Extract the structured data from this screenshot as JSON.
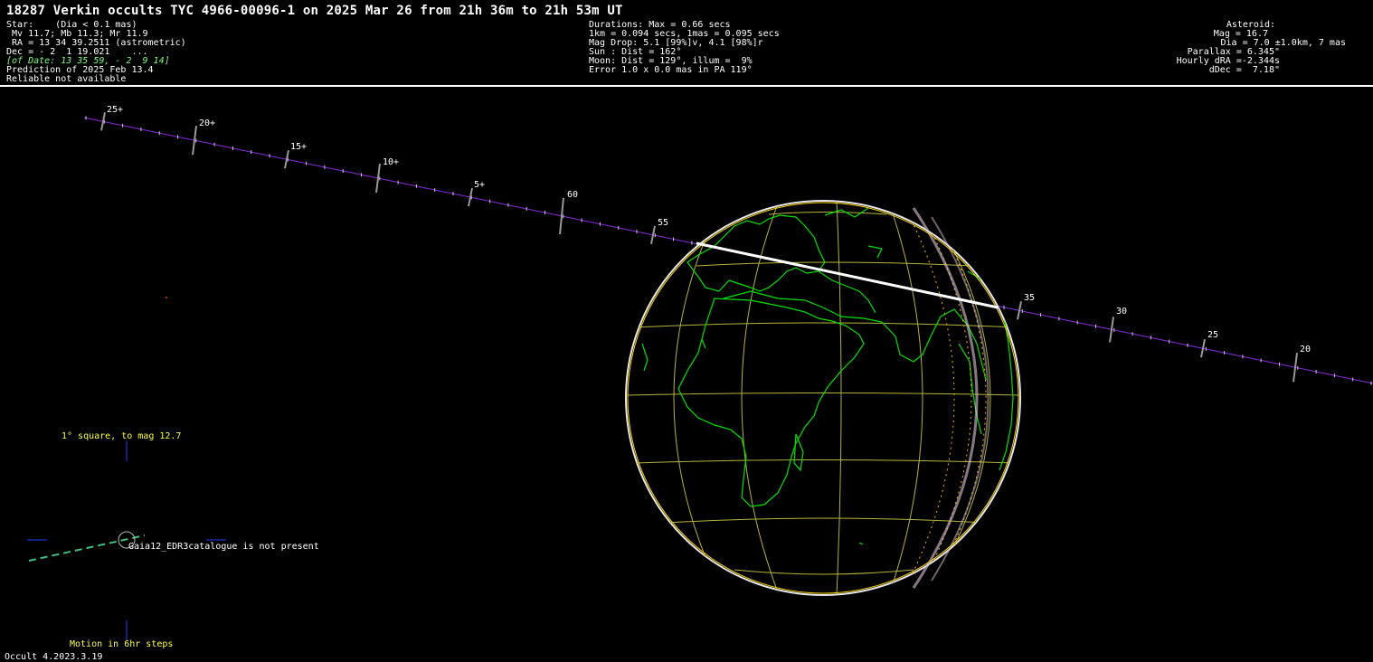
{
  "header": {
    "title": "18287 Verkin occults TYC 4966-00096-1 on 2025 Mar 26 from 21h 36m to 21h 53m UT",
    "star": {
      "line1": "Star:    (Dia < 0.1 mas)",
      "line2": " Mv 11.7; Mb 11.3; Mr 11.9",
      "line3": " RA = 13 34 39.2511 (astrometric)",
      "line4": "Dec = - 2  1 19.021    ...",
      "line5": "[of Date: 13 35 59, - 2  9 14]",
      "line6": "Prediction of 2025 Feb 13.4",
      "line7": "Reliable not available"
    },
    "event": {
      "line1": "Durations: Max = 0.66 secs",
      "line2": "1km = 0.094 secs, 1mas = 0.095 secs",
      "line3": "Mag Drop: 5.1 [99%]v, 4.1 [98%]r",
      "line4": "Sun : Dist = 162°",
      "line5": "Moon: Dist = 129°, illum =  9%",
      "line6": "Error 1.0 x 0.0 mas in PA 119°"
    },
    "asteroid": {
      "line1": "Asteroid:",
      "line2": "Mag = 16.7",
      "line3": "Dia = 7.0 ±1.0km, 7 mas",
      "line4": "Parallax = 6.345\"",
      "line5": "Hourly dRA =-2.344s",
      "line6": "dDec =  7.18\""
    }
  },
  "track": {
    "labels_before": [
      "25+",
      "20+",
      "15+",
      "10+",
      "5+",
      "60",
      "55"
    ],
    "labels_after": [
      "35",
      "30",
      "25",
      "20"
    ]
  },
  "finder": {
    "title": "1° square, to mag 12.7",
    "notice": "Gaia12_EDR3catalogue is not present",
    "motion": "Motion in 6hr steps"
  },
  "footer": {
    "version": "Occult 4.2023.3.19"
  },
  "colors": {
    "coast": "#00e000",
    "grid": "#b4b43c",
    "track": "#8a2be2",
    "path": "#ffffff",
    "limb": "#ffd700"
  }
}
